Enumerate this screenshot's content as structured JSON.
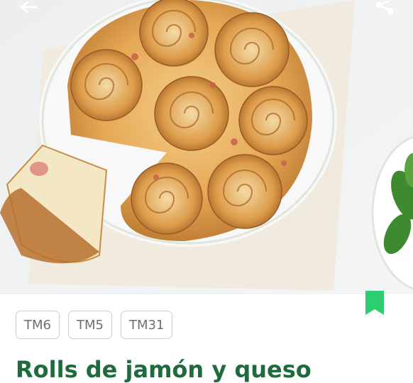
{
  "recipe": {
    "title": "Rolls de jamón y queso",
    "tags": [
      "TM6",
      "TM5",
      "TM31"
    ],
    "bookmarked": true
  },
  "icons": {
    "back": "arrow-left-icon",
    "share": "share-icon",
    "bookmark": "bookmark-icon"
  },
  "colors": {
    "accent_green": "#2ecc71",
    "title_green": "#1f6b3d",
    "chip_border": "#c9ccd0",
    "chip_text": "#6a6e73"
  }
}
